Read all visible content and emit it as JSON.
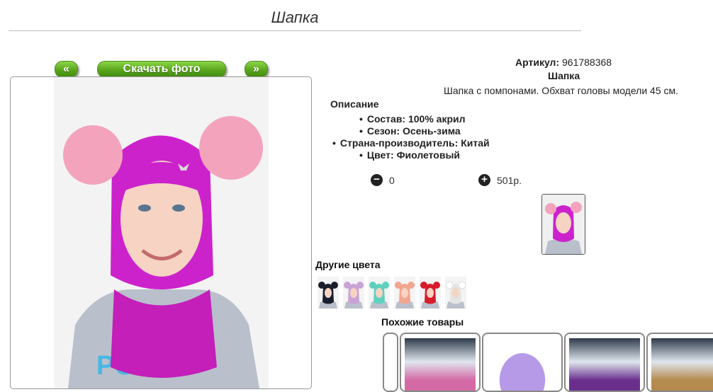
{
  "page": {
    "title": "Шапка"
  },
  "gallery": {
    "prev_label": "«",
    "download_label": "Скачать фото",
    "next_label": "»"
  },
  "product": {
    "article_label": "Артикул:",
    "article_value": "961788368",
    "name": "Шапка",
    "short_description": "Шапка с помпонами. Обхват головы модели 45 см.",
    "description_heading": "Описание",
    "specs": [
      "Состав: 100% акрил",
      "Сезон: Осень-зима",
      "Страна-производитель: Китай",
      "Цвет: Фиолетовый"
    ]
  },
  "cart": {
    "minus_symbol": "−",
    "plus_symbol": "+",
    "quantity": "0",
    "price": "501р."
  },
  "other_colors": {
    "heading": "Другие цвета",
    "swatches": [
      {
        "name": "black",
        "color": "#1a1f2e"
      },
      {
        "name": "lilac",
        "color": "#c9a3d6"
      },
      {
        "name": "mint",
        "color": "#5fd0bd"
      },
      {
        "name": "peach",
        "color": "#f2a58f"
      },
      {
        "name": "red",
        "color": "#d81c2a"
      },
      {
        "name": "white",
        "color": "#eeeeee"
      }
    ]
  },
  "similar": {
    "heading": "Похожие товары"
  },
  "colors": {
    "accent_green": "#5aa51c",
    "hat_magenta": "#cc22cc",
    "pompom_pink": "#f4a3bd"
  }
}
